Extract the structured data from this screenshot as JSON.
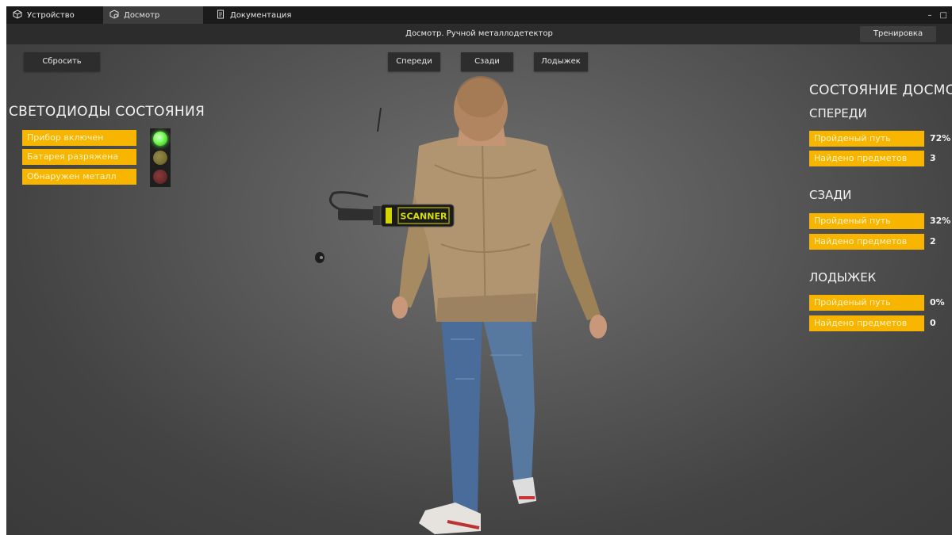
{
  "tabs": [
    {
      "label": "Устройство",
      "icon": "cube-outline-icon",
      "active": false
    },
    {
      "label": "Досмотр",
      "icon": "cube-search-icon",
      "active": true
    },
    {
      "label": "Документация",
      "icon": "document-icon",
      "active": false
    }
  ],
  "window_controls": {
    "minimize": "–",
    "maximize": "□"
  },
  "title": "Досмотр. Ручной металлодетектор",
  "training_button": "Тренировка",
  "reset_button": "Сбросить",
  "view_buttons": [
    "Спереди",
    "Сзади",
    "Лодыжек"
  ],
  "leds": {
    "heading": "СВЕТОДИОДЫ СОСТОЯНИЯ",
    "items": [
      {
        "label": "Прибор включен",
        "color": "#7cff5a",
        "state": "on"
      },
      {
        "label": "Батарея разряжена",
        "color": "#7a6f30",
        "state": "off"
      },
      {
        "label": "Обнаружен металл",
        "color": "#6a2a2a",
        "state": "off"
      }
    ]
  },
  "inspection": {
    "heading": "СОСТОЯНИЕ ДОСМОТРА",
    "path_label": "Пройденый путь",
    "items_label": "Найдено предметов",
    "sections": [
      {
        "name": "СПЕРЕДИ",
        "path": "72%",
        "found": "3"
      },
      {
        "name": "СЗАДИ",
        "path": "32%",
        "found": "2"
      },
      {
        "name": "ЛОДЫЖЕК",
        "path": "0%",
        "found": "0"
      }
    ]
  },
  "scanner_text": "SCANNER",
  "accent_color": "#f7b500"
}
